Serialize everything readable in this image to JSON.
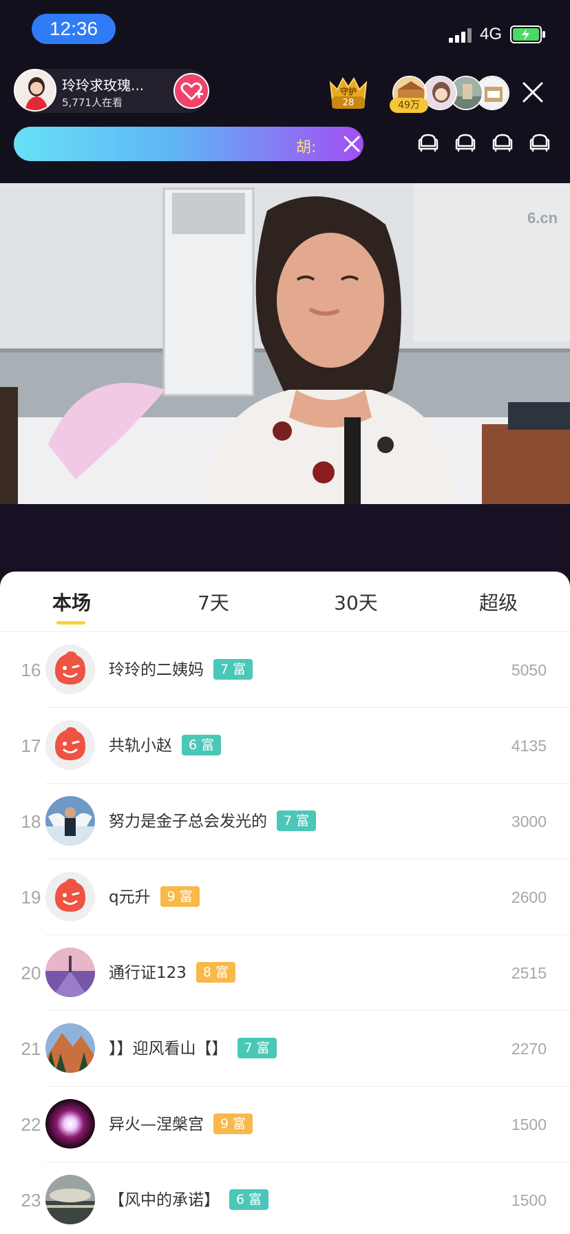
{
  "status_bar": {
    "time": "12:36",
    "network": "4G"
  },
  "host": {
    "name": "玲玲求玫瑰...",
    "viewers": "5,771人在看"
  },
  "guard": {
    "label": "守护",
    "count": "28"
  },
  "fans": {
    "count": "49万"
  },
  "marquee": {
    "text": "胡:"
  },
  "watermark": "6.cn",
  "tabs": [
    {
      "label": "本场"
    },
    {
      "label": "7天"
    },
    {
      "label": "30天"
    },
    {
      "label": "超级"
    }
  ],
  "ranking": [
    {
      "rank": "16",
      "name": "玲玲的二姨妈",
      "level": "7 富",
      "score": "5050",
      "avatar": "default"
    },
    {
      "rank": "17",
      "name": "共轨小赵",
      "level": "6 富",
      "score": "4135",
      "avatar": "default"
    },
    {
      "rank": "18",
      "name": "努力是金子总会发光的",
      "level": "7 富",
      "score": "3000",
      "avatar": "photo-man"
    },
    {
      "rank": "19",
      "name": "q元升",
      "level": "9 富",
      "score": "2600",
      "avatar": "default"
    },
    {
      "rank": "20",
      "name": "通行证123",
      "level": "8 富",
      "score": "2515",
      "avatar": "photo-lavender"
    },
    {
      "rank": "21",
      "name": "】】迎风看山【】",
      "level": "7 富",
      "score": "2270",
      "avatar": "photo-mountain"
    },
    {
      "rank": "22",
      "name": "异火—涅槃宫",
      "level": "9 富",
      "score": "1500",
      "avatar": "photo-orb"
    },
    {
      "rank": "23",
      "name": "【风中的承诺】",
      "level": "6 富",
      "score": "1500",
      "avatar": "photo-sky"
    }
  ],
  "colors": {
    "level_teal": "#4ac7b7",
    "level_orange": "#f8b84a",
    "follow": "#f0436b",
    "time_pill": "#2f7cf6"
  }
}
